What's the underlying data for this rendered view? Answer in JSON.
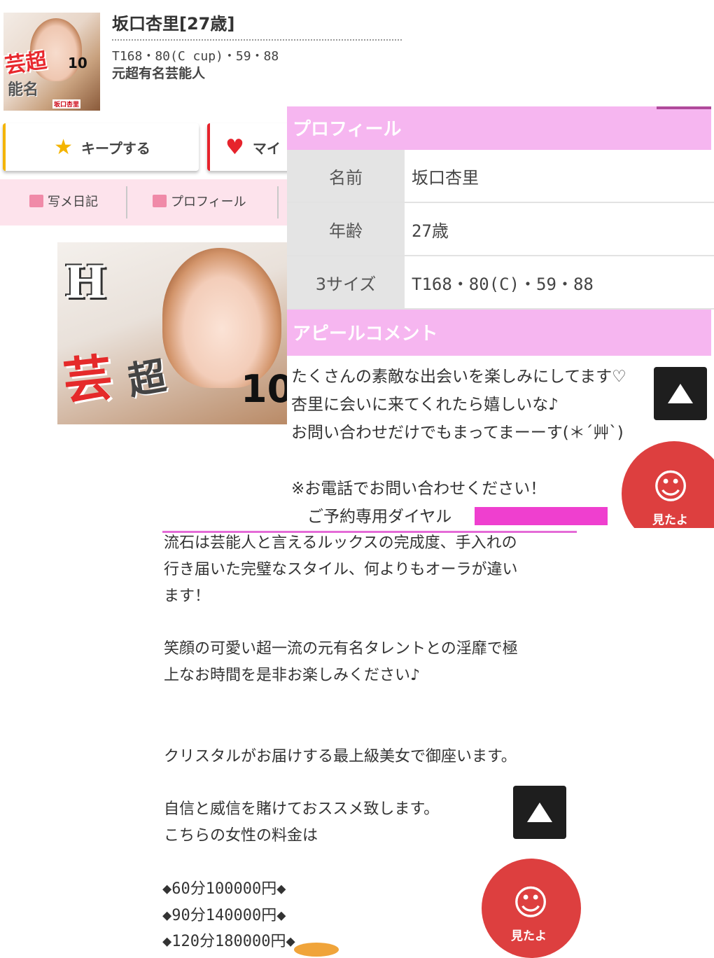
{
  "profile": {
    "name_title": "坂口杏里[27歳]",
    "spec": "T168・80(C cup)・59・88",
    "category": "元超有名芸能人",
    "thumb_text": {
      "tag": "芸超",
      "sub": "能名",
      "num": "10",
      "name": "坂口杏里"
    }
  },
  "actions": {
    "keep_label": "キープする",
    "my_label": "マイ"
  },
  "tabs": [
    {
      "label": "写メ日記"
    },
    {
      "label": "プロフィール"
    }
  ],
  "photo_text": {
    "letter": "H",
    "geino": "芸",
    "cho": "超",
    "num": "10"
  },
  "profile_panel": {
    "header": "プロフィール",
    "rows": [
      {
        "key": "名前",
        "value": "坂口杏里"
      },
      {
        "key": "年齢",
        "value": "27歳"
      },
      {
        "key": "3サイズ",
        "value": "T168・80(C)・59・88"
      }
    ],
    "appeal_header": "アピールコメント",
    "appeal_lines": [
      "たくさんの素敵な出会いを楽しみにしてます♡",
      "杏里に会いに来てくれたら嬉しいな♪",
      "お問い合わせだけでもまってまーーす(＊´艸`)",
      "",
      "※お電話でお問い合わせください！",
      "　ご予約専用ダイヤル"
    ]
  },
  "floating": {
    "mitayo_label": "見たよ"
  },
  "description": {
    "para1": "流石は芸能人と言えるルックスの完成度、手入れの\n行き届いた完璧なスタイル、何よりもオーラが違い\nます！",
    "para2": "笑顔の可愛い超一流の元有名タレントとの淫靡で極\n上なお時間を是非お楽しみください♪",
    "para3": "クリスタルがお届けする最上級美女で御座います。",
    "para4": "自信と威信を賭けておススメ致します。\nこちらの女性の料金は",
    "prices": [
      "◆60分100000円◆",
      "◆90分140000円◆",
      "◆120分180000円◆"
    ]
  },
  "colors": {
    "pink_header": "#f6b6f0",
    "pink_tab": "#fde3ec",
    "keep_accent": "#f4b400",
    "my_accent": "#e6232c",
    "mitayo": "#dd3f3f",
    "redaction": "#ef3fcf"
  }
}
